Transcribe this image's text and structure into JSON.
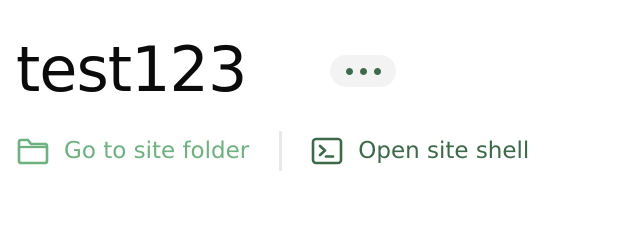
{
  "site": {
    "title": "test123"
  },
  "menu": {
    "icon": "more-horizontal-icon"
  },
  "actions": {
    "folder": {
      "label": "Go to site folder",
      "icon": "folder-icon"
    },
    "shell": {
      "label": "Open site shell",
      "icon": "terminal-icon"
    }
  },
  "colors": {
    "folder_green": "#6cb27e",
    "shell_green": "#3a6a48",
    "title": "#0b0b0b",
    "menu_bg": "#f3f3f3"
  }
}
